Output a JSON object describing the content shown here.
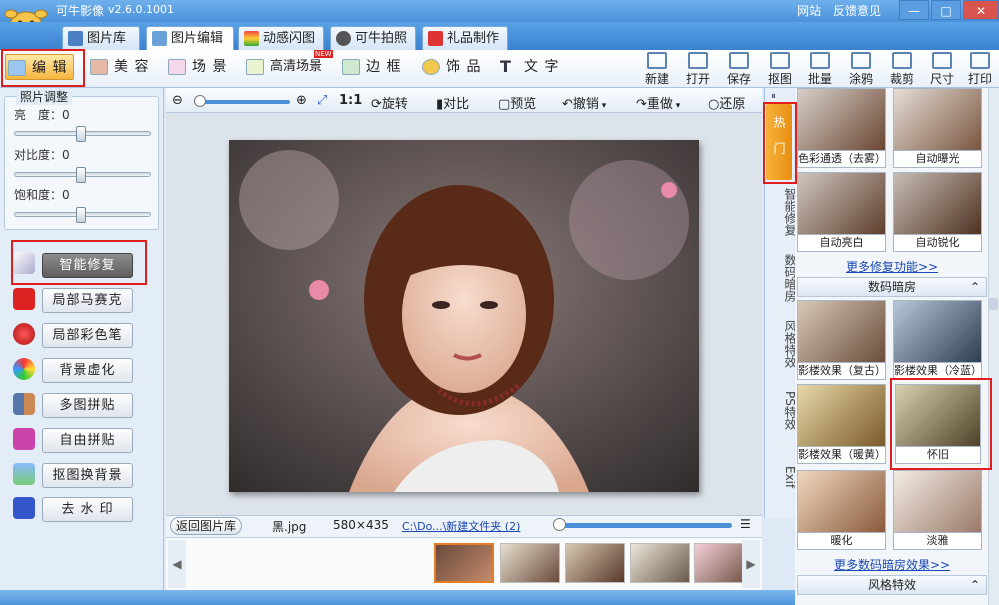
{
  "app": {
    "title": "可牛影像",
    "version": "v2.6.0.1001",
    "links": [
      "网站",
      "反馈意见"
    ],
    "window_buttons": [
      "—",
      "□",
      "✕"
    ]
  },
  "tabs": [
    {
      "label": "图片库"
    },
    {
      "label": "图片编辑"
    },
    {
      "label": "动感闪图"
    },
    {
      "label": "可牛拍照"
    },
    {
      "label": "礼品制作"
    }
  ],
  "toolbar": {
    "tools": [
      "编 辑",
      "美 容",
      "场 景",
      "高清场景",
      "边 框",
      "饰 品",
      "文 字"
    ],
    "new_badge": "NEW",
    "right_tools": [
      "新建",
      "打开",
      "保存",
      "抠图",
      "批量",
      "涂鸦",
      "裁剪",
      "尺寸",
      "打印"
    ]
  },
  "left_panel": {
    "adjust_title": "照片调整",
    "sliders": [
      {
        "label": "亮　度：",
        "value": 0
      },
      {
        "label": "对比度：",
        "value": 0
      },
      {
        "label": "饱和度：",
        "value": 0
      }
    ],
    "buttons": [
      "智能修复",
      "局部马赛克",
      "局部彩色笔",
      "背景虚化",
      "多图拼贴",
      "自由拼贴",
      "抠图换背景",
      "去 水 印"
    ]
  },
  "center_toolbar": {
    "zoom_1to1": "1:1",
    "rotate": "旋转",
    "compare": "对比",
    "preview": "预览",
    "undo": "撤销",
    "redo": "重做",
    "restore": "还原"
  },
  "statusbar": {
    "back_button": "返回图片库",
    "filename": "黑.jpg",
    "dimensions": "580×435",
    "path": "C:\\Do...\\新建文件夹 (2)"
  },
  "vertical_tabs": [
    "热门",
    "智能修复",
    "数码暗房",
    "风格特效",
    "PS特效",
    "Exif"
  ],
  "right_panel": {
    "hot_effects": [
      "色彩通透（去雾）",
      "自动曝光",
      "自动亮白",
      "自动锐化"
    ],
    "more_repair": "更多修复功能>>",
    "darkroom_title": "数码暗房",
    "darkroom_effects": [
      "影楼效果（复古）",
      "影楼效果（冷蓝）",
      "影楼效果（暖黄）",
      "怀旧",
      "暖化",
      "淡雅"
    ],
    "more_darkroom": "更多数码暗房效果>>",
    "style_title": "风格特效",
    "collapse_icon": "⌃"
  },
  "icons": {
    "zoom_out": "⊖",
    "zoom_in": "⊕",
    "left_arrow": "◀",
    "right_arrow": "▶"
  }
}
